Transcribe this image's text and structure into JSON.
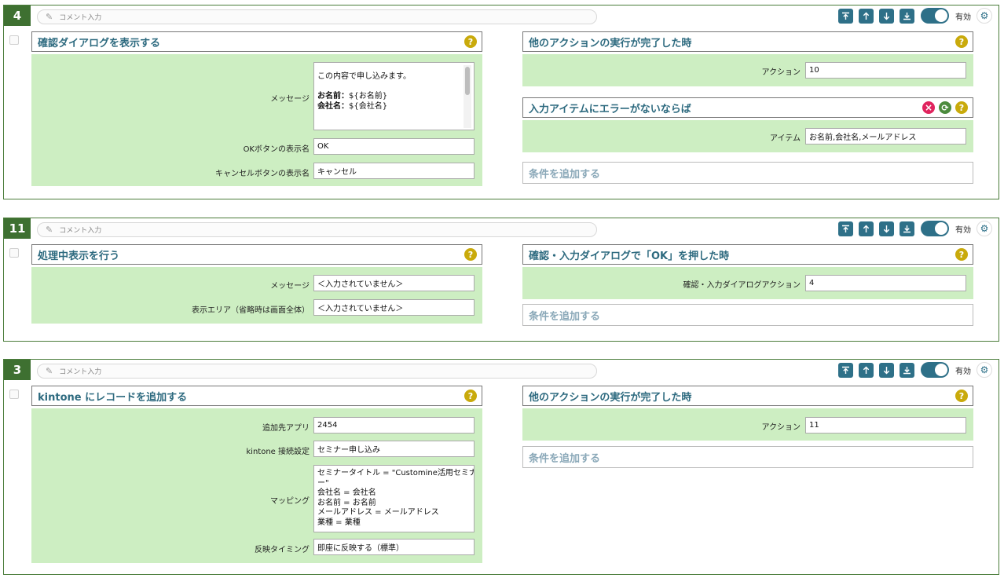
{
  "blocks": [
    {
      "number": "4",
      "comment_placeholder": "コメント入力",
      "toggle_label": "有効",
      "action": {
        "title": "確認ダイアログを表示する",
        "message_label": "メッセージ",
        "message_lines": [
          {
            "text": "この内容で申し込みます。",
            "bold": ""
          },
          {
            "text": "",
            "bold": ""
          },
          {
            "bold": "お名前：",
            "text": "${お名前}"
          },
          {
            "bold": "会社名：",
            "text": "${会社名}"
          }
        ],
        "ok_label": "OKボタンの表示名",
        "ok_value": "OK",
        "cancel_label": "キャンセルボタンの表示名",
        "cancel_value": "キャンセル"
      },
      "condition1": {
        "title": "他のアクションの実行が完了した時",
        "field_label": "アクション",
        "field_value": "10"
      },
      "condition2": {
        "title": "入力アイテムにエラーがないならば",
        "field_label": "アイテム",
        "field_value": "お名前,会社名,メールアドレス"
      },
      "add_condition": "条件を追加する"
    },
    {
      "number": "11",
      "comment_placeholder": "コメント入力",
      "toggle_label": "有効",
      "action": {
        "title": "処理中表示を行う",
        "message_label": "メッセージ",
        "message_value": "＜入力されていません＞",
        "area_label": "表示エリア（省略時は画面全体）",
        "area_value": "＜入力されていません＞"
      },
      "condition1": {
        "title": "確認・入力ダイアログで「OK」を押した時",
        "field_label": "確認・入力ダイアログアクション",
        "field_value": "4"
      },
      "add_condition": "条件を追加する"
    },
    {
      "number": "3",
      "comment_placeholder": "コメント入力",
      "toggle_label": "有効",
      "action": {
        "title": "kintone にレコードを追加する",
        "app_label": "追加先アプリ",
        "app_value": "2454",
        "conn_label": "kintone 接続設定",
        "conn_value": "セミナー申し込み",
        "mapping_label": "マッピング",
        "mapping_lines": [
          "セミナータイトル = \"Customine活用セミナ",
          "ー\"",
          "会社名 = 会社名",
          "お名前 = お名前",
          "メールアドレス = メールアドレス",
          "業種 = 業種"
        ],
        "timing_label": "反映タイミング",
        "timing_value": "即座に反映する（標準）"
      },
      "condition1": {
        "title": "他のアクションの実行が完了した時",
        "field_label": "アクション",
        "field_value": "11"
      },
      "add_condition": "条件を追加する"
    }
  ],
  "colors": {
    "block_border": "#4a7c3a",
    "block_number_bg": "#3e7031",
    "toolbar_button": "#2e7088",
    "card_title": "#2d6a7f",
    "card_body": "#cdeec2",
    "help": "#c9aa0b",
    "delete": "#e0245e",
    "refresh": "#4c8b3e"
  },
  "icons": {
    "toolbar": [
      "move-top-icon",
      "move-up-icon",
      "move-down-icon",
      "move-bottom-icon"
    ],
    "help": "help-icon",
    "settings": "gear-icon",
    "comment": "pencil-icon"
  }
}
